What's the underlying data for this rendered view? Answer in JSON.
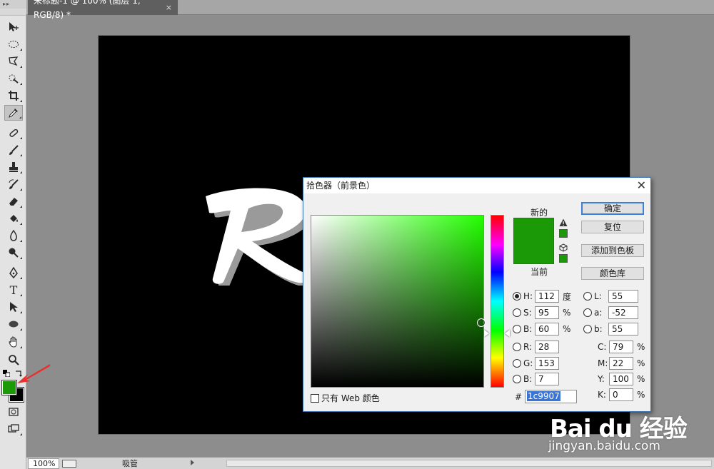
{
  "document": {
    "tab_title": "未标题-1 @ 100% (图层 1, RGB/8) *",
    "close_glyph": "×"
  },
  "canvas": {
    "background": "#000000",
    "artwork_text": "Ro"
  },
  "toolbar": {
    "grip": "▸▸",
    "tools": [
      {
        "name": "move-tool",
        "icon": "move-icon"
      },
      {
        "name": "marquee-tool",
        "icon": "ellipse-marquee-icon"
      },
      {
        "name": "lasso-tool",
        "icon": "polygonal-lasso-icon"
      },
      {
        "name": "quick-select-tool",
        "icon": "quick-select-icon"
      },
      {
        "name": "crop-tool",
        "icon": "crop-icon"
      },
      {
        "name": "eyedropper-tool",
        "icon": "eyedropper-icon",
        "active": true
      },
      {
        "name": "healing-tool",
        "icon": "bandage-icon"
      },
      {
        "name": "brush-tool",
        "icon": "brush-icon"
      },
      {
        "name": "stamp-tool",
        "icon": "stamp-icon"
      },
      {
        "name": "history-brush-tool",
        "icon": "history-brush-icon"
      },
      {
        "name": "eraser-tool",
        "icon": "eraser-icon"
      },
      {
        "name": "bucket-tool",
        "icon": "paint-bucket-icon"
      },
      {
        "name": "blur-tool",
        "icon": "drop-icon"
      },
      {
        "name": "dodge-tool",
        "icon": "dodge-icon"
      },
      {
        "name": "pen-tool",
        "icon": "pen-icon"
      },
      {
        "name": "type-tool",
        "icon": "type-icon",
        "glyph": "T"
      },
      {
        "name": "path-select-tool",
        "icon": "arrow-icon"
      },
      {
        "name": "shape-tool",
        "icon": "ellipse-shape-icon"
      },
      {
        "name": "hand-tool",
        "icon": "hand-icon"
      },
      {
        "name": "zoom-tool",
        "icon": "magnifier-icon"
      }
    ],
    "foreground_color": "#1c9907",
    "background_color": "#000000"
  },
  "status": {
    "zoom": "100%",
    "tool": "吸管"
  },
  "color_picker": {
    "title": "拾色器（前景色）",
    "close": "✕",
    "new_label": "新的",
    "current_label": "当前",
    "new_color": "#1c9907",
    "current_color": "#1c9907",
    "buttons": {
      "ok": "确定",
      "reset": "复位",
      "add_swatch": "添加到色板",
      "color_library": "颜色库"
    },
    "hsb": [
      {
        "label": "H:",
        "value": "112",
        "unit": "度",
        "selected": true
      },
      {
        "label": "S:",
        "value": "95",
        "unit": "%"
      },
      {
        "label": "B:",
        "value": "60",
        "unit": "%"
      }
    ],
    "rgb": [
      {
        "label": "R:",
        "value": "28"
      },
      {
        "label": "G:",
        "value": "153"
      },
      {
        "label": "B:",
        "value": "7"
      }
    ],
    "lab": [
      {
        "label": "L:",
        "value": "55"
      },
      {
        "label": "a:",
        "value": "-52"
      },
      {
        "label": "b:",
        "value": "55"
      }
    ],
    "cmyk": [
      {
        "label": "C:",
        "value": "79",
        "unit": "%"
      },
      {
        "label": "M:",
        "value": "22",
        "unit": "%"
      },
      {
        "label": "Y:",
        "value": "100",
        "unit": "%"
      },
      {
        "label": "K:",
        "value": "0",
        "unit": "%"
      }
    ],
    "web_only_label": "只有 Web 颜色",
    "hex_label": "#",
    "hex_value": "1c9907"
  },
  "watermark": {
    "logo": "Bai du 经验",
    "url": "jingyan.baidu.com"
  },
  "annotation": {
    "arrow_color": "#e8302e"
  }
}
